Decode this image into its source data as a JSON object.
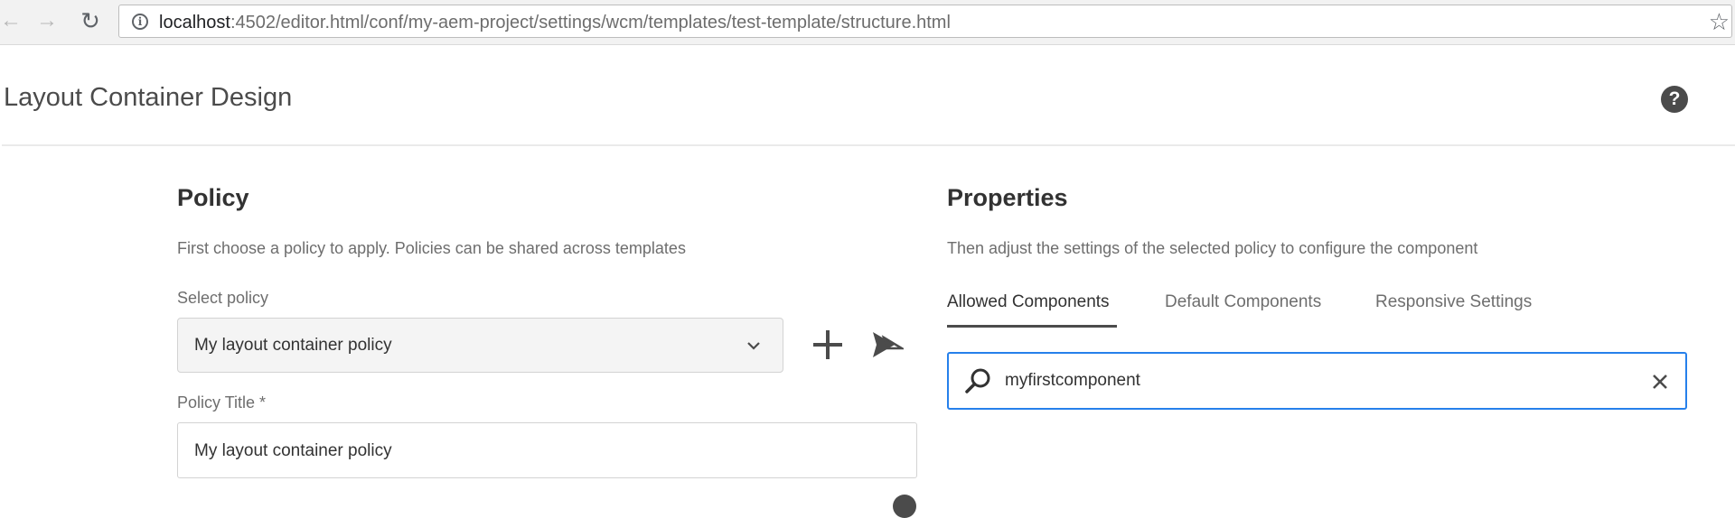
{
  "browser": {
    "url_host": "localhost",
    "url_rest": ":4502/editor.html/conf/my-aem-project/settings/wcm/templates/test-template/structure.html",
    "icons": {
      "back": "back-arrow-icon",
      "forward": "forward-arrow-icon",
      "reload": "reload-icon",
      "info": "info-icon",
      "bookmark": "star-icon"
    }
  },
  "dialog": {
    "title": "Layout Container Design",
    "help_icon": "help-icon"
  },
  "policy": {
    "heading": "Policy",
    "description": "First choose a policy to apply. Policies can be shared across templates",
    "select_label": "Select policy",
    "select_value": "My layout container policy",
    "title_label": "Policy Title *",
    "title_value": "My layout container policy"
  },
  "properties": {
    "heading": "Properties",
    "description": "Then adjust the settings of the selected policy to configure the component",
    "tabs": [
      {
        "label": "Allowed Components",
        "active": true
      },
      {
        "label": "Default Components",
        "active": false
      },
      {
        "label": "Responsive Settings",
        "active": false
      }
    ],
    "search_value": "myfirstcomponent"
  },
  "colors": {
    "focus_border": "#2680eb",
    "heading_text": "#323232",
    "muted_text": "#6e6e6e"
  }
}
